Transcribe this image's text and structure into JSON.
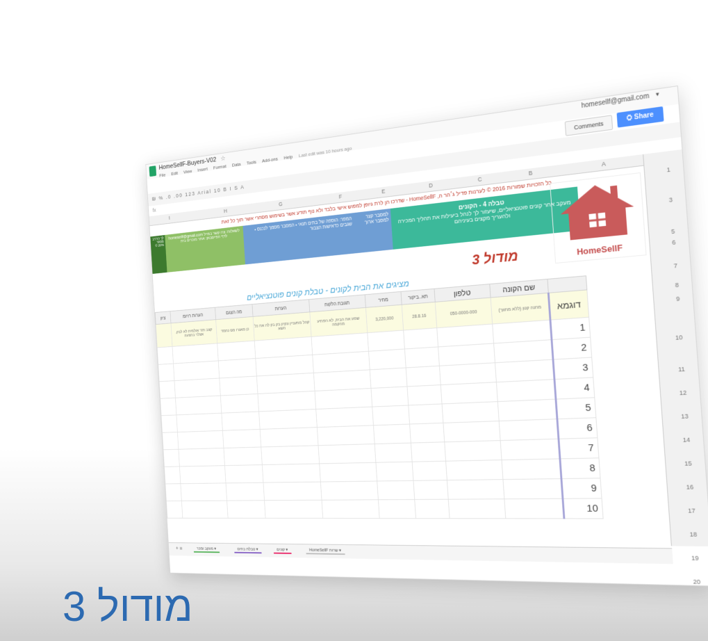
{
  "window": {
    "title": "HomeSellF-Buyers-V02",
    "account": "homesellf@gmail.com",
    "share_label": "Share",
    "comments_label": "Comments"
  },
  "menu": [
    "File",
    "Edit",
    "View",
    "Insert",
    "Format",
    "Data",
    "Tools",
    "Add-ons",
    "Help"
  ],
  "last_edit": "Last edit was 10 hours ago",
  "toolbar_text": "₪ % .0 .00 123 Arial 10 B I S A",
  "column_letters": [
    "A",
    "B",
    "C",
    "D",
    "E",
    "F",
    "G",
    "H",
    "I"
  ],
  "row_numbers": [
    "1",
    "3",
    "5",
    "6",
    "7",
    "8",
    "9",
    "10",
    "11",
    "12",
    "13",
    "14",
    "15",
    "16",
    "17",
    "18",
    "19",
    "20"
  ],
  "credit_text": "כל הזכויות שמורות 2016 © לערנות פדיל ג׳הר ה, HomeSellF - שדרכו הן לרת גיופן למפוש אישי בלבד ולא נוף תודע אשר בשימוש מסחרי אשר תוך כל זאת",
  "banner": {
    "dark": "לך הרכיב מספר 20% ©",
    "green": "לשאלות: צרו קשר במייל homesellf@gmail.com לדף הפייסבוק: אתר מוכרים בית",
    "blue_left": "למסבר קצר \n למסבר ארוך",
    "blue_right": "המפר: הוספה של בתים תנאי • המסבר מסמך לנכנס • שגבים כדאישות הצבור",
    "teal_title": "טבלה 4 - הקונים",
    "teal_body": "מעקב אחר קונים פוטנציאליים, שיעזור לך לנהל ביעילות את תהליך המכירה ולהעריך מקצים בעיניהם"
  },
  "logo": {
    "text": "HomeSellF"
  },
  "module_heading": "מודול 3",
  "table_title": "מציגים את הבית לקונים - טבלת קונים פוטנציאליים",
  "headers": [
    "שם הקונה",
    "טלפון",
    "תא..ביקור",
    "מחיר",
    "תגובת הלקוח",
    "הערות",
    "מה הצגם",
    "הערות רזיומ",
    "ציון"
  ],
  "example_row": {
    "label": "דוגמא",
    "cells": [
      "מחנה קטן (ללא מתווך)",
      "050-0000-000",
      "28.8.16",
      "3,220,000",
      "שמע את הבית, לא הפתיע מהקמה",
      "קהל מתעניין ונקיון בק בק לה את כל השא",
      "כן מאגרו מס נחמד",
      "קצב חזר אולמית לא לבק. אצלר בהצעה"
    ]
  },
  "row_labels": [
    "1",
    "2",
    "3",
    "4",
    "5",
    "6",
    "7",
    "8",
    "9",
    "10"
  ],
  "tabs": [
    "מעקב ומכר ▾",
    "טבלת בתים ▾",
    "קונים ▾",
    "HomeSellF שרות ▾"
  ],
  "bottom_heading": "מודול 3"
}
